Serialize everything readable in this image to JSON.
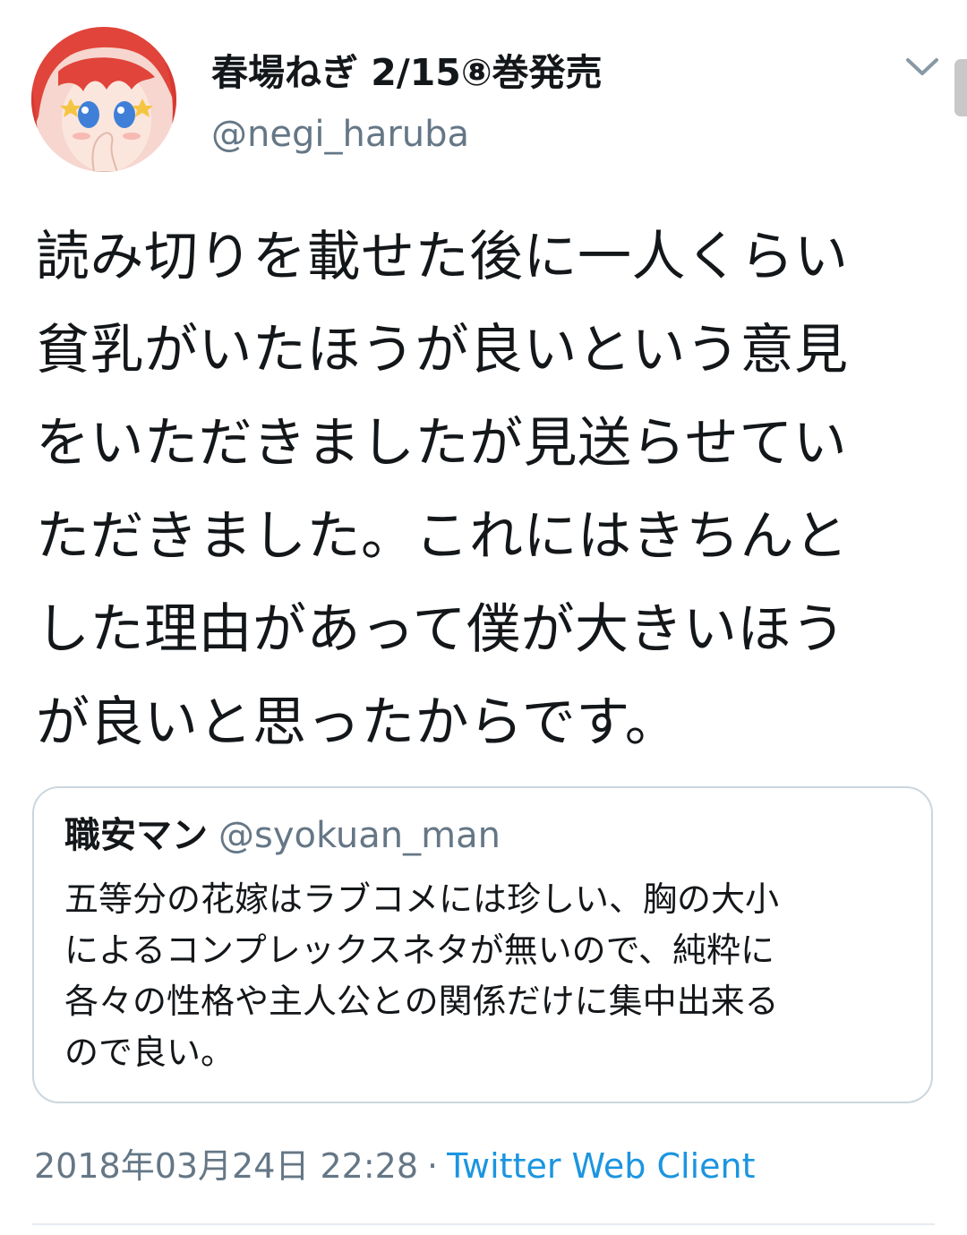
{
  "author": {
    "display_name": "春場ねぎ 2/15⑧巻発売",
    "handle": "@negi_haruba",
    "avatar_icon": "avatar-illustration-icon"
  },
  "tweet": {
    "lines": [
      "読み切りを載せた後に一人くらい",
      "貧乳がいたほうが良いという意見",
      "をいただきましたが見送らせてい",
      "ただきました。これにはきちんと",
      "した理由があって僕が大きいほう",
      "が良いと思ったからです。"
    ]
  },
  "quoted_tweet": {
    "display_name": "職安マン",
    "handle": "@syokuan_man",
    "lines": [
      "五等分の花嫁はラブコメには珍しい、胸の大小",
      "によるコンプレックスネタが無いので、純粋に",
      "各々の性格や主人公との関係だけに集中出来る",
      "ので良い。"
    ]
  },
  "meta": {
    "timestamp": "2018年03月24日 22:28",
    "separator": "·",
    "client": "Twitter Web Client"
  },
  "colors": {
    "text": "#14171a",
    "secondary": "#657786",
    "link": "#1b95e0",
    "border": "#ccd6dd"
  }
}
